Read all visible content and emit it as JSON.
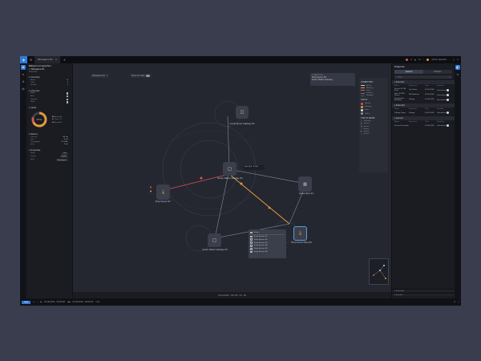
{
  "topbar": {
    "tab_label": "Workspace #1",
    "tab_close": "×",
    "add_tab": "+",
    "alerts_count": "0",
    "warnings_count": "11",
    "user_name": "Admin Operator",
    "window_controls": [
      "–",
      "□",
      "×"
    ]
  },
  "left_panel": {
    "title": "Network & Inspection",
    "workspace_name": "Workspace #1",
    "workspace_sub": "Overview",
    "sections": [
      {
        "name": "Summary",
        "rows": [
          [
            "Nodes",
            "6"
          ],
          [
            "Links",
            "7"
          ],
          [
            "Groups",
            "2"
          ]
        ]
      },
      {
        "name": "Channels",
        "rows": [
          [
            "Alpha",
            "on"
          ],
          [
            "Beta",
            "on"
          ],
          [
            "Gamma",
            "on"
          ],
          [
            "Delta",
            "on"
          ]
        ]
      },
      {
        "name": "Alerts",
        "rows": [
          [
            "Warning",
            "2"
          ],
          [
            "Error",
            "1"
          ],
          [
            "Normal",
            "3"
          ]
        ]
      },
      {
        "name": "Metrics",
        "rows": [
          [
            "Latency",
            "42 ms"
          ],
          [
            "Loss",
            "0.1%"
          ],
          [
            "Throughput",
            "1.2 Gb/s"
          ],
          [
            "Jitter",
            "3 ms"
          ]
        ]
      },
      {
        "name": "Properties",
        "rows": [
          [
            "Mode",
            "Live"
          ],
          [
            "Layout",
            "Radial"
          ],
          [
            "Filter",
            "Workspace"
          ]
        ]
      }
    ],
    "donut_value": "67%"
  },
  "canvas": {
    "workspace_select": "Workspace #1",
    "toggle_label": "Show all nodes",
    "nodes": [
      {
        "id": "n1",
        "label": "Anode Sensor Gateway #2",
        "icon": "box-icon"
      },
      {
        "id": "n2",
        "label": "Sensor Master Gateway #1",
        "icon": "box-icon"
      },
      {
        "id": "n3",
        "label": "Temp Sensor #3",
        "icon": "thermometer-icon"
      },
      {
        "id": "n4",
        "label": "Server Rack #1",
        "icon": "server-icon"
      },
      {
        "id": "n5",
        "label": "Sensor Master Gateway #3",
        "icon": "box-icon"
      },
      {
        "id": "n6",
        "label": "Temp Sensor Node #4",
        "icon": "thermometer-icon"
      }
    ],
    "center_readout": "Link 14.5 · 10.00",
    "tooltip": {
      "title": "CONNECTION",
      "line1": "Temp Sensor #4",
      "line2": "Sensor Master Gateway"
    },
    "legend": {
      "connection_title": "CONNECTION",
      "connections": [
        {
          "label": "Active",
          "color": "#c9cdd6"
        },
        {
          "label": "Warning",
          "color": "#e39a3b"
        },
        {
          "label": "Error",
          "color": "#e05353"
        },
        {
          "label": "Inactive",
          "color": "#6b7080"
        },
        {
          "label": "Disabled",
          "color": "#4a4f5c"
        }
      ],
      "status_title": "STATUS",
      "statuses": [
        {
          "label": "Normal",
          "color": "#e05353"
        },
        {
          "label": "Warning",
          "color": "#e39a3b"
        },
        {
          "label": "Error",
          "color": "#d9dce3"
        },
        {
          "label": "Offline",
          "color": "#8b91a0"
        }
      ],
      "types_title": "TYPE OF NODES",
      "types": [
        "Gateway",
        "Sensor",
        "Server",
        "Router",
        "Switch",
        "Device"
      ]
    },
    "popup": {
      "header": "Device",
      "rows": [
        "Temp Sensor #1",
        "Temp Sensor #2",
        "Temp Sensor #3",
        "Temp Sensor #4",
        "Temp Sensor #5",
        "Temp Sensor #6"
      ]
    }
  },
  "status_bar": {
    "text": "01.01.2024   ·   HH: 00 : 52 : 00"
  },
  "right_panel": {
    "title": "Diagnose",
    "tabs": [
      "General",
      "Detailed"
    ],
    "search_placeholder": "Find",
    "sections": [
      {
        "name": "Standard",
        "columns": [
          "Name",
          "Parameter",
          "Time",
          "Duration"
        ],
        "rows": [
          [
            "Sensor #1 SPI-Error",
            "Low Value",
            "02.06.2024",
            "Unresolved"
          ],
          [
            "Sens Tilt BPI-Status",
            "SPI-Problems",
            "02.06.2024",
            "Unresolved"
          ],
          [
            "Temperature Anomaly",
            "Voltage",
            "02.06.2024",
            "Unresolved"
          ]
        ]
      },
      {
        "name": "Extended",
        "columns": [
          "Name",
          "Parameter",
          "Time",
          "Duration"
        ],
        "rows": [
          [
            "Voltage Drops",
            "Voltage",
            "03.06.2024",
            "Unresolved"
          ]
        ]
      },
      {
        "name": "Deviant",
        "columns": [
          "Name",
          "Parameter",
          "Time",
          "Duration"
        ],
        "rows": [
          [
            "Sensor Derivation",
            "",
            "03.06.2024",
            "Unresolved"
          ]
        ]
      }
    ],
    "footer_sections": [
      "Extended",
      "Deviant"
    ]
  },
  "bottom_bar": {
    "button_label": "Logs",
    "time_start": "01.06.2024 · 00:00:00",
    "time_end": "01.06.2024 · 00:00:00",
    "zoom": "1.0x"
  }
}
